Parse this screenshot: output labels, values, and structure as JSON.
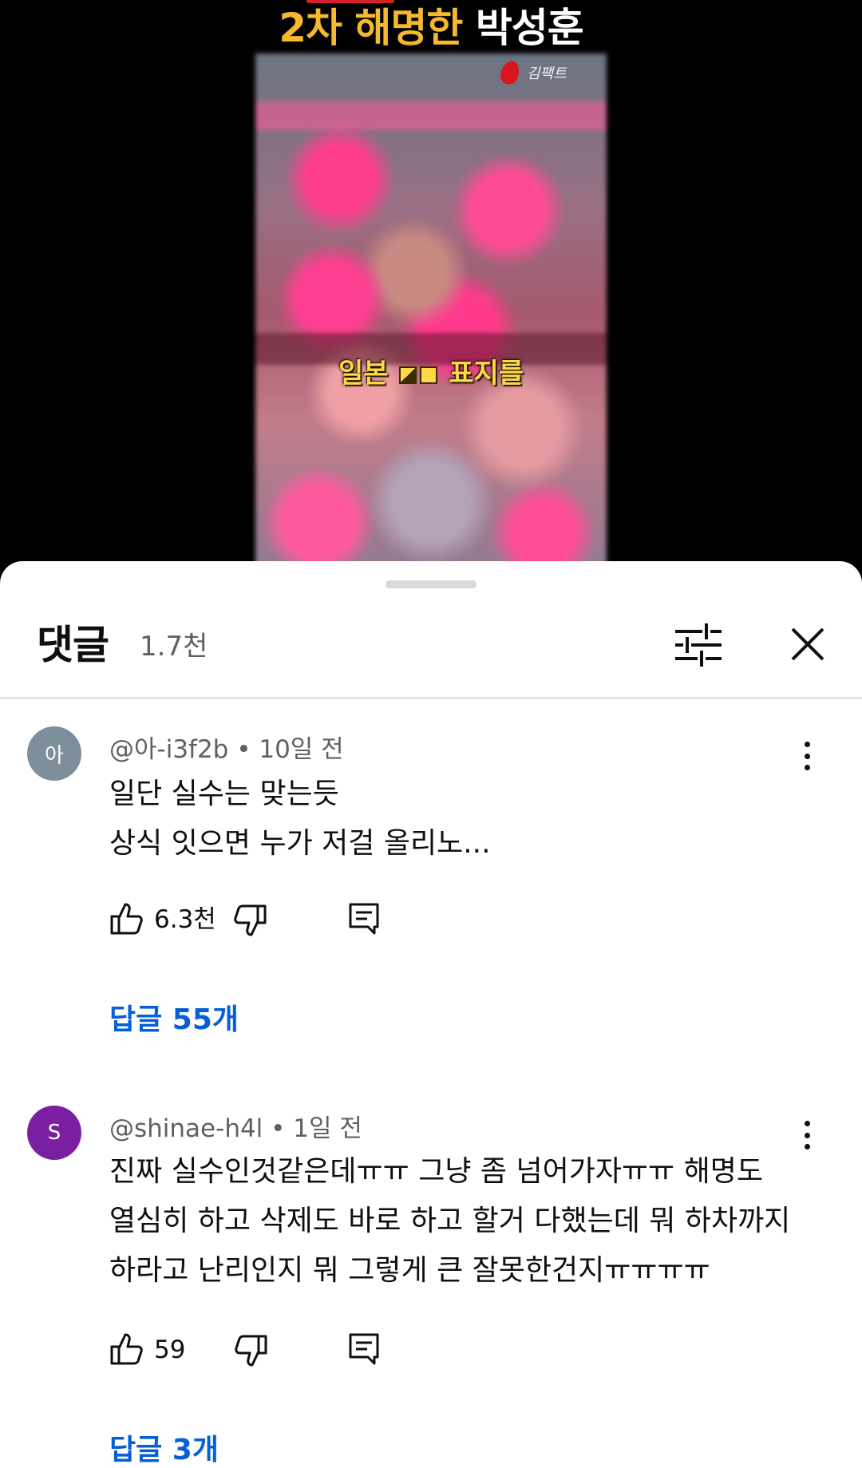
{
  "video": {
    "title_highlight": "2차 해명한",
    "title_name": "박성훈",
    "channel_name": "김팩트",
    "caption_left": "일본",
    "caption_right": "표지를"
  },
  "comments_panel": {
    "title": "댓글",
    "count": "1.7천",
    "filter_icon": "sliders-icon",
    "close_icon": "close-icon"
  },
  "comments": [
    {
      "avatar_text": "아",
      "avatar_color": "#7d8f9b",
      "author": "@아-i3f2b",
      "time": "10일 전",
      "lines": [
        "일단 실수는 맞는듯",
        "상식 잇으면 누가 저걸 올리노..."
      ],
      "likes": "6.3천",
      "replies": "답글 55개"
    },
    {
      "avatar_text": "S",
      "avatar_color": "#7b1fa2",
      "author": "@shinae-h4l",
      "time": "1일 전",
      "lines": [
        "진짜 실수인것같은데ㅠㅠ 그냥 좀 넘어가자ㅠㅠ 해명도",
        "열심히 하고 삭제도 바로 하고 할거 다했는데 뭐 하차까지",
        "하라고 난리인지 뭐 그렇게 큰 잘못한건지ㅠㅠㅠㅠ"
      ],
      "likes": "59",
      "replies": "답글 3개"
    }
  ]
}
